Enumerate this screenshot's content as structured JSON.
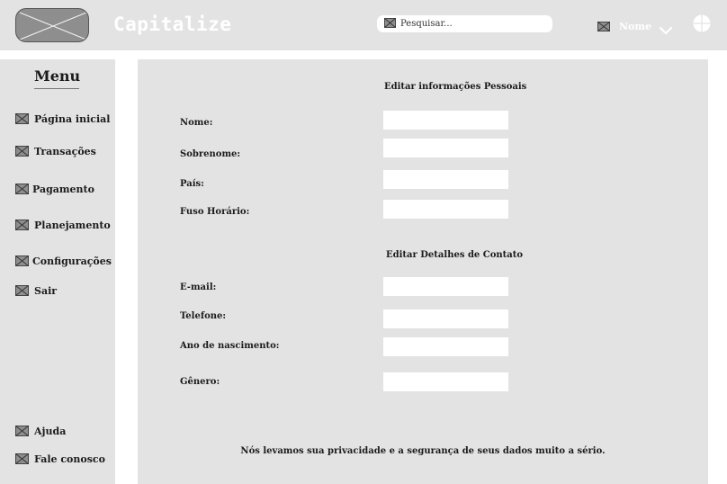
{
  "header": {
    "app_title": "Capitalize",
    "search_placeholder": "Pesquisar...",
    "user_name": "Nome"
  },
  "sidebar": {
    "title": "Menu",
    "items": [
      {
        "label": "Página inicial"
      },
      {
        "label": "Transações"
      },
      {
        "label": "Pagamento"
      },
      {
        "label": "Planejamento"
      },
      {
        "label": "Configurações"
      },
      {
        "label": "Sair"
      }
    ],
    "footer_items": [
      {
        "label": "Ajuda"
      },
      {
        "label": "Fale conosco"
      }
    ]
  },
  "main": {
    "personal": {
      "title": "Editar informações Pessoais",
      "fields": [
        {
          "label": "Nome:",
          "value": ""
        },
        {
          "label": "Sobrenome:",
          "value": ""
        },
        {
          "label": "País:",
          "value": ""
        },
        {
          "label": "Fuso Horário:",
          "value": ""
        }
      ]
    },
    "contact": {
      "title": "Editar Detalhes de Contato",
      "fields": [
        {
          "label": "E-mail:",
          "value": ""
        },
        {
          "label": "Telefone:",
          "value": ""
        },
        {
          "label": "Ano de nascimento:",
          "value": ""
        },
        {
          "label": "Gênero:",
          "value": ""
        }
      ]
    },
    "privacy_note": "Nós levamos sua privacidade e a segurança de seus dados muito a sério."
  },
  "icons": {
    "logo": "logo-placeholder-icon",
    "placeholder": "image-placeholder-icon",
    "chevron": "chevron-down-icon",
    "globe": "globe-icon"
  },
  "colors": {
    "panel_background": "#e3e3e3",
    "page_background": "#ffffff",
    "placeholder_gray": "#8e8e8e"
  }
}
